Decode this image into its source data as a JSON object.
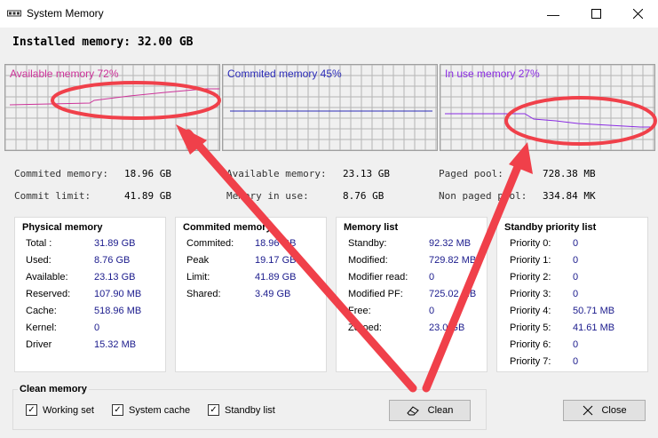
{
  "window": {
    "title": "System Memory"
  },
  "installed": {
    "label": "Installed memory:",
    "value": "32.00 GB"
  },
  "graphs": [
    {
      "label": "Available memory 72%",
      "color": "#cc3399"
    },
    {
      "label": "Commited memory 45%",
      "color": "#2b2bb8"
    },
    {
      "label": "In use memory 27%",
      "color": "#8a2be2"
    }
  ],
  "stats": {
    "commited_memory": {
      "label": "Commited memory:",
      "value": "18.96 GB"
    },
    "commit_limit": {
      "label": "Commit limit:",
      "value": "41.89 GB"
    },
    "available_memory": {
      "label": "Available memory:",
      "value": "23.13 GB"
    },
    "memory_in_use": {
      "label": "Memory in use:",
      "value": "8.76 GB"
    },
    "paged_pool": {
      "label": "Paged pool:",
      "value": "728.38 MB"
    },
    "non_paged_pool": {
      "label": "Non paged pool:",
      "value": "334.84 MK"
    }
  },
  "physical": {
    "title": "Physical memory",
    "rows": [
      {
        "label": "Total :",
        "value": "31.89 GB"
      },
      {
        "label": "Used:",
        "value": "8.76 GB"
      },
      {
        "label": "Available:",
        "value": "23.13 GB"
      },
      {
        "label": "Reserved:",
        "value": "107.90 MB"
      },
      {
        "label": "Cache:",
        "value": "518.96 MB"
      },
      {
        "label": "Kernel:",
        "value": "0"
      },
      {
        "label": "Driver",
        "value": "15.32 MB"
      }
    ]
  },
  "commited": {
    "title": "Commited memory",
    "rows": [
      {
        "label": "Commited:",
        "value": "18.96 GB"
      },
      {
        "label": "Peak",
        "value": "19.17 GB"
      },
      {
        "label": "Limit:",
        "value": "41.89 GB"
      },
      {
        "label": "Shared:",
        "value": "3.49 GB"
      }
    ]
  },
  "memlist": {
    "title": "Memory list",
    "rows": [
      {
        "label": "Standby:",
        "value": "92.32 MB"
      },
      {
        "label": "Modified:",
        "value": "729.82 MB"
      },
      {
        "label": "Modifier read:",
        "value": "0"
      },
      {
        "label": "Modified PF:",
        "value": "725.02 MB"
      },
      {
        "label": "Free:",
        "value": "0"
      },
      {
        "label": "Zeroed:",
        "value": "23.0 GB"
      }
    ]
  },
  "standby": {
    "title": "Standby priority list",
    "rows": [
      {
        "label": "Priority 0:",
        "value": "0"
      },
      {
        "label": "Priority 1:",
        "value": "0"
      },
      {
        "label": "Priority 2:",
        "value": "0"
      },
      {
        "label": "Priority 3:",
        "value": "0"
      },
      {
        "label": "Priority 4:",
        "value": "50.71 MB"
      },
      {
        "label": "Priority 5:",
        "value": "41.61 MB"
      },
      {
        "label": "Priority 6:",
        "value": "0"
      },
      {
        "label": "Priority 7:",
        "value": "0"
      }
    ]
  },
  "clean": {
    "title": "Clean memory",
    "options": [
      {
        "label": "Working set",
        "checked": true
      },
      {
        "label": "System cache",
        "checked": true
      },
      {
        "label": "Standby list",
        "checked": true
      }
    ],
    "clean_label": "Clean",
    "close_label": "Close"
  },
  "annotation_color": "#f0404a"
}
